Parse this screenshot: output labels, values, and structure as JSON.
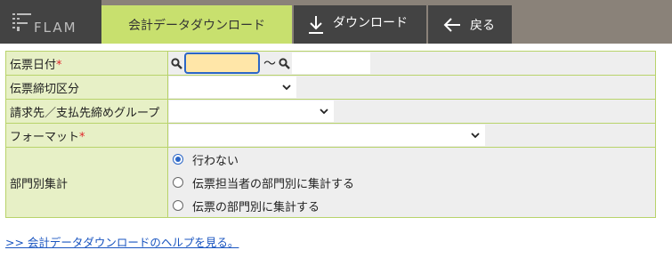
{
  "header": {
    "logo_text": "FLAM",
    "active_tab": "会計データダウンロード",
    "download_label": "ダウンロード",
    "back_label": "戻る"
  },
  "form": {
    "date": {
      "label": "伝票日付",
      "required_mark": "*",
      "range_separator": "〜",
      "from_value": "",
      "to_value": ""
    },
    "closing_category": {
      "label": "伝票締切区分",
      "value": ""
    },
    "billing_group": {
      "label": "請求先／支払先締めグループ",
      "value": ""
    },
    "format": {
      "label": "フォーマット",
      "required_mark": "*",
      "value": ""
    },
    "department": {
      "label": "部門別集計",
      "options": [
        {
          "label": "行わない",
          "selected": true
        },
        {
          "label": "伝票担当者の部門別に集計する",
          "selected": false
        },
        {
          "label": "伝票の部門別に集計する",
          "selected": false
        }
      ]
    }
  },
  "help_link": ">> 会計データダウンロードのヘルプを見る。",
  "colors": {
    "accent_tab": "#c8e06e",
    "header_bg": "#8a8279",
    "focus_blue": "#2b66c6",
    "label_bg": "#e7f0c6"
  },
  "icons": [
    "flam-logo-icon",
    "download-arrow-icon",
    "back-arrow-icon",
    "search-icon",
    "chevron-down-icon"
  ]
}
